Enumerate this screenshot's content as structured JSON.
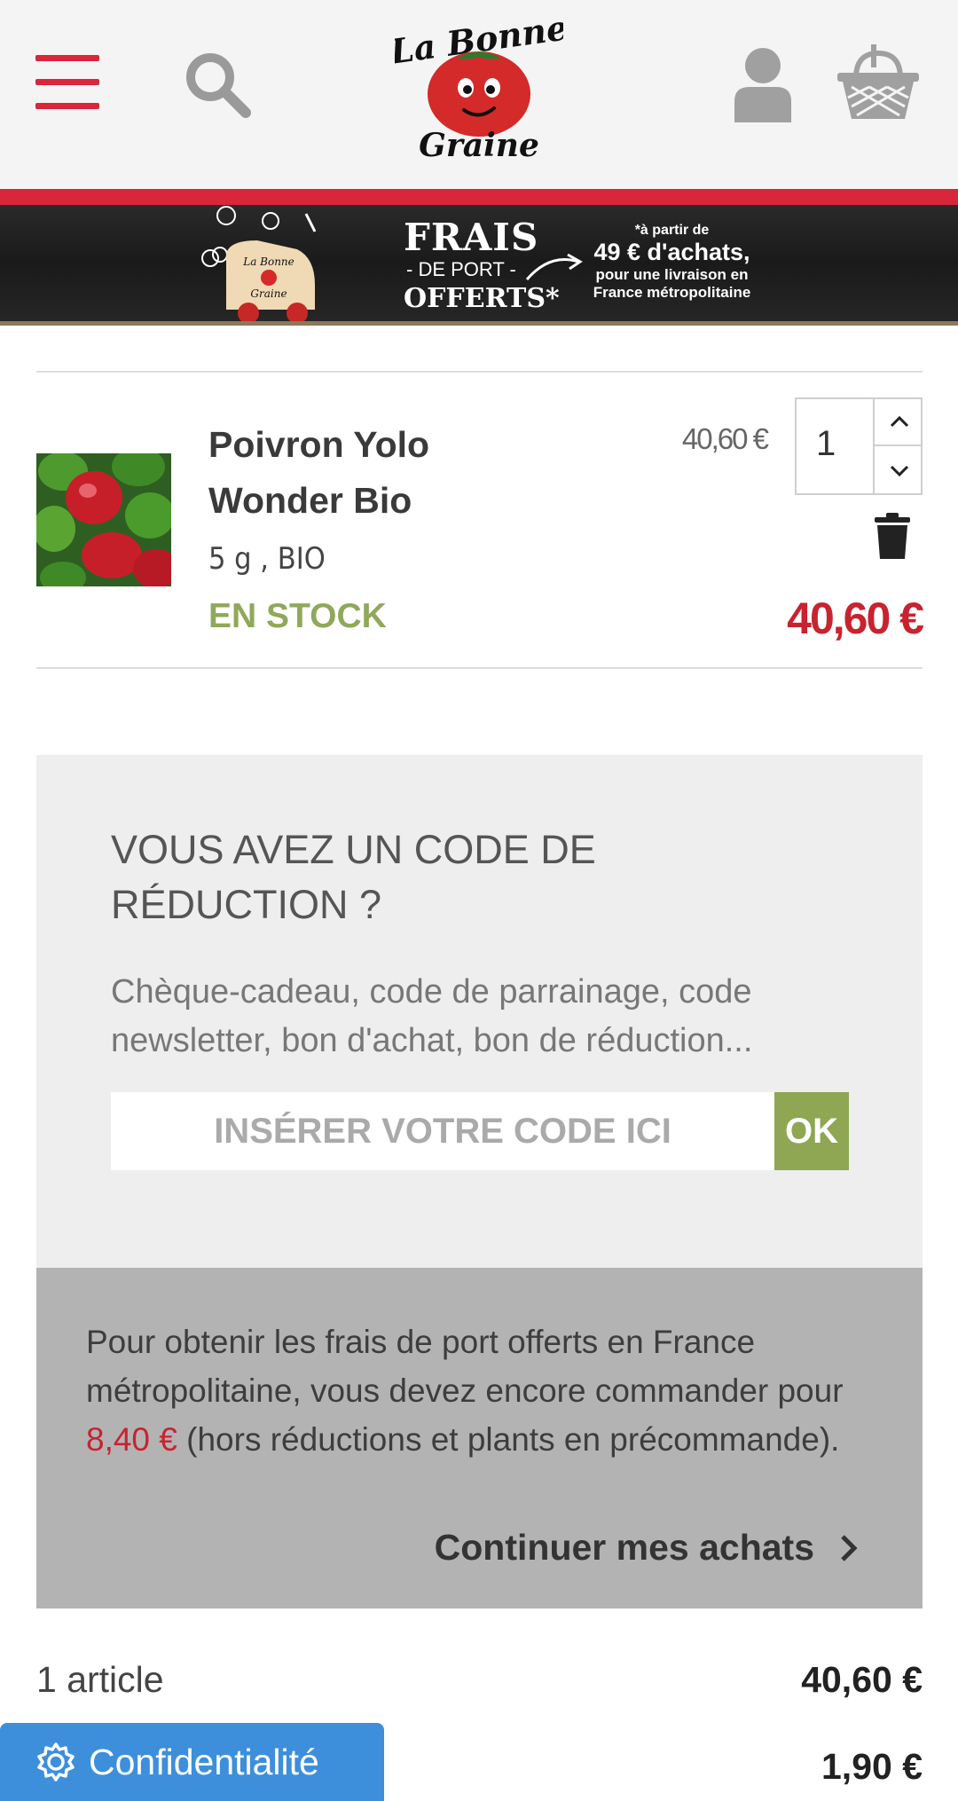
{
  "header": {
    "logo_line1": "La Bonne",
    "logo_line2": "Graine",
    "icons": [
      "menu-icon",
      "search-icon",
      "user-icon",
      "basket-icon"
    ],
    "accent_color": "#d9263a"
  },
  "banner": {
    "frais": "FRAIS",
    "de_port": "- DE PORT -",
    "offerts": "OFFERTS*",
    "note_a": "*à partir de",
    "note_b": "49 € d'achats,",
    "note_c1": "pour une livraison en",
    "note_c2": "France métropolitaine",
    "truck_label_1": "La Bonne",
    "truck_label_2": "Graine"
  },
  "cart_item": {
    "name": "Poivron Yolo Wonder Bio",
    "attributes": "5 g , BIO",
    "stock": "EN STOCK",
    "unit_price": "40,60 €",
    "quantity": "1",
    "total": "40,60 €"
  },
  "discount": {
    "title": "VOUS AVEZ UN CODE DE RÉDUCTION ?",
    "subtitle": "Chèque-cadeau, code de parrainage, code newsletter, bon d'achat, bon de réduction...",
    "placeholder": "INSÉRER VOTRE CODE ICI",
    "ok_label": "OK"
  },
  "shipping": {
    "text_before": "Pour obtenir les frais de port offerts en France métropolitaine, vous devez encore commander pour ",
    "amount": "8,40 €",
    "text_after": " (hors réductions et plants en précommande).",
    "continue_label": "Continuer mes achats"
  },
  "summary": {
    "articles_label": "1 article",
    "articles_value": "40,60 €",
    "shipping_value": "1,90 €"
  },
  "privacy": {
    "label": "Confidentialité"
  }
}
